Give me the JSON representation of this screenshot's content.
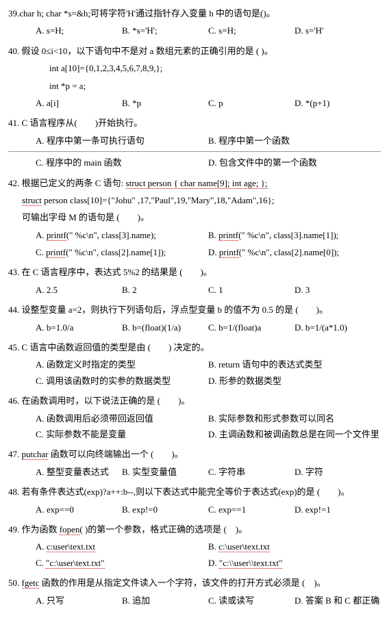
{
  "questions": [
    {
      "num": "39",
      "text": "char h; char *s=&h;可将字符'H'通过指针存入变量 h 中的语句是()。",
      "options_layout": "4col",
      "options": [
        {
          "label": "A.",
          "text": "s=H;"
        },
        {
          "label": "B.",
          "text": "*s='H';"
        },
        {
          "label": "C.",
          "text": "s=H;"
        },
        {
          "label": "D.",
          "text": "s='H'"
        }
      ]
    },
    {
      "num": "40",
      "text": "假设 0≤i<10，以下语句中不是对 a 数组元素的正确引用的是 ( )。",
      "code": [
        "int a[10]={0,1,2,3,4,5,6,7,8,9,};",
        "int  *p = a;"
      ],
      "options_layout": "4col",
      "options": [
        {
          "label": "A.",
          "text": "a[i]"
        },
        {
          "label": "B.",
          "text": "*p"
        },
        {
          "label": "C.",
          "text": "p"
        },
        {
          "label": "D.",
          "text": "*(p+1)"
        }
      ]
    },
    {
      "num": "41",
      "text": "C 语言程序从(　　)开始执行。",
      "options_layout": "2col_split",
      "options": [
        {
          "label": "A.",
          "text": "程序中第一条可执行语句"
        },
        {
          "label": "B.",
          "text": "程序中第一个函数"
        },
        {
          "label": "C.",
          "text": "程序中的 main 函数"
        },
        {
          "label": "D.",
          "text": "包含文件中的第一个函数"
        }
      ]
    },
    {
      "num": "42",
      "text_parts": [
        "根据已定义的两条 C 语句: ",
        "struct person { char name[9]; int age; };"
      ],
      "line2_parts": [
        "struct",
        " person class[10]={\"Johu\" ,17,\"Paul\",19,\"Mary\",18,\"Adam\",16};"
      ],
      "line3": "可输出字母 M 的语句是 (　　)。",
      "options_layout": "printf",
      "options": [
        {
          "label": "A.",
          "func": "printf",
          "args": "(\" %c\\n\", class[3].name);"
        },
        {
          "label": "B.",
          "func": "printf",
          "args": "(\" %c\\n\", class[3].name[1]);"
        },
        {
          "label": "C.",
          "func": "printf",
          "args": "(\" %c\\n\", class[2].name[1]);"
        },
        {
          "label": "D.",
          "func": "printf",
          "args": "(\" %c\\n\", class[2].name[0]);"
        }
      ]
    },
    {
      "num": "43",
      "text": "在 C 语言程序中，表达式 5%2 的结果是 (　　)。",
      "options_layout": "4col",
      "options": [
        {
          "label": "A.",
          "text": "2.5"
        },
        {
          "label": "B.",
          "text": "2"
        },
        {
          "label": "C.",
          "text": "1"
        },
        {
          "label": "D.",
          "text": "3"
        }
      ]
    },
    {
      "num": "44",
      "text": "设整型变量 a=2，则执行下列语句后，浮点型变量 b 的值不为 0.5 的是 (　　)。",
      "options_layout": "4col",
      "options": [
        {
          "label": "A.",
          "text": "b=1.0/a"
        },
        {
          "label": "B.",
          "text": "b=(float)(1/a)"
        },
        {
          "label": "C.",
          "text": "b=1/(float)a"
        },
        {
          "label": "D.",
          "text": "b=1/(a*1.0)"
        }
      ]
    },
    {
      "num": "45",
      "text": "C 语言中函数返回值的类型是由 (　　) 决定的。",
      "options_layout": "2col",
      "options": [
        {
          "label": "A.",
          "text": "函数定义时指定的类型"
        },
        {
          "label": "B.",
          "text": "return 语句中的表达式类型"
        },
        {
          "label": "C.",
          "text": "调用该函数时的实参的数据类型"
        },
        {
          "label": "D.",
          "text": "形参的数据类型"
        }
      ]
    },
    {
      "num": "46",
      "text": "在函数调用时，以下说法正确的是 (　　)。",
      "options_layout": "2col",
      "options": [
        {
          "label": "A.",
          "text": "函数调用后必须带回返回值"
        },
        {
          "label": "B.",
          "text": "实际参数和形式参数可以同名"
        },
        {
          "label": "C.",
          "text": "实际参数不能是变量"
        },
        {
          "label": "D.",
          "text": "主调函数和被调函数总是在同一个文件里"
        }
      ]
    },
    {
      "num": "47",
      "text_parts_dotted": [
        {
          "dotted": true,
          "text": "putchar"
        },
        {
          "dotted": false,
          "text": " 函数可以向终端输出一个 (　　)。"
        }
      ],
      "options_layout": "4col",
      "options": [
        {
          "label": "A.",
          "text": "整型变量表达式"
        },
        {
          "label": "B.",
          "text": "实型变量值"
        },
        {
          "label": "C.",
          "text": "字符串"
        },
        {
          "label": "D.",
          "text": "字符"
        }
      ]
    },
    {
      "num": "48",
      "text": "若有条件表达式(exp)?a++:b--,则以下表达式中能完全等价于表达式(exp)的是 (　　)。",
      "options_layout": "4col",
      "options": [
        {
          "label": "A.",
          "text": "exp==0"
        },
        {
          "label": "B.",
          "text": "exp!=0"
        },
        {
          "label": "C.",
          "text": "exp==1"
        },
        {
          "label": "D.",
          "text": "exp!=1"
        }
      ]
    },
    {
      "num": "49",
      "text_parts_dotted": [
        {
          "dotted": false,
          "text": "作为函数 "
        },
        {
          "dotted": true,
          "text": "fopen"
        },
        {
          "dotted": false,
          "text": "( )的第一个参数，格式正确的选项是 (　)。"
        }
      ],
      "options_layout": "2col_dotted",
      "options": [
        {
          "label": "A.",
          "text": "c:user\\text.txt",
          "dotted": true
        },
        {
          "label": "B.",
          "text": "c:\\user\\text.txt",
          "dotted": true
        },
        {
          "label": "C.",
          "text": "\"c:\\user\\text.txt\"",
          "dotted": true
        },
        {
          "label": "D.",
          "text": "\"c:\\\\user\\\\text.txt\"",
          "dotted": true
        }
      ]
    },
    {
      "num": "50",
      "text_parts_dotted": [
        {
          "dotted": true,
          "text": "fgetc"
        },
        {
          "dotted": false,
          "text": " 函数的作用是从指定文件读入一个字符，该文件的打开方式必须是 (　)。"
        }
      ],
      "options_layout": "4col",
      "options": [
        {
          "label": "A.",
          "text": "只写"
        },
        {
          "label": "B.",
          "text": "追加"
        },
        {
          "label": "C.",
          "text": "读或读写"
        },
        {
          "label": "D.",
          "text": "答案 B 和 C 都正确"
        }
      ]
    }
  ]
}
